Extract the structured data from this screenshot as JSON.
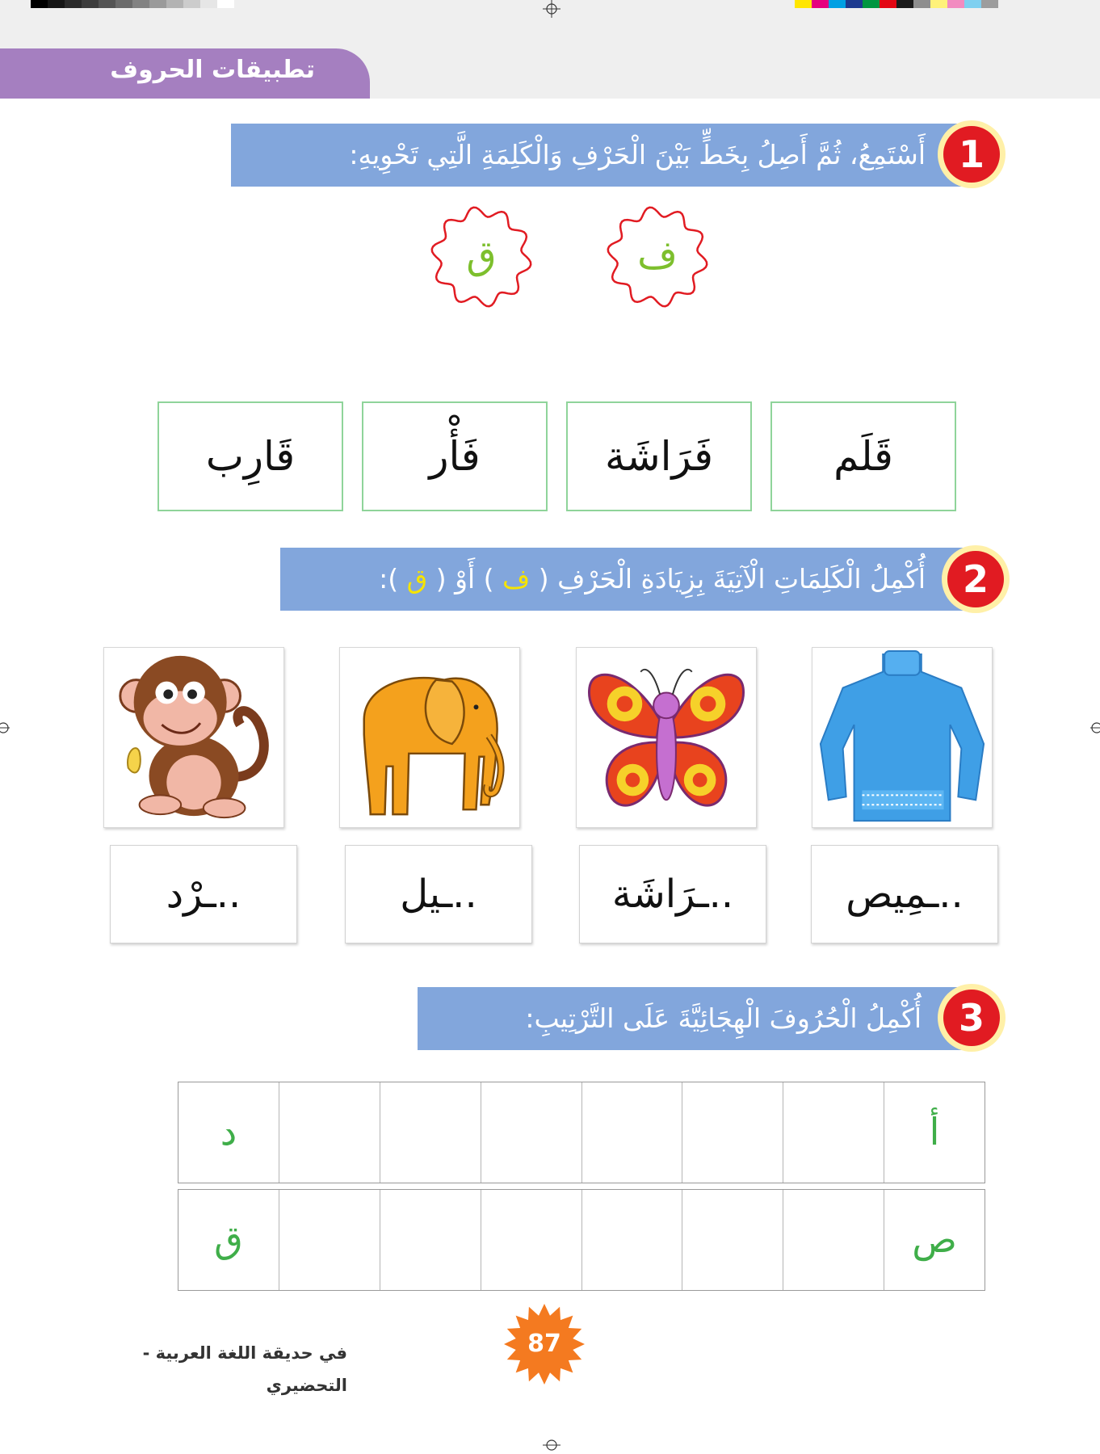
{
  "header": {
    "tab_title": "تطبيقات الحروف",
    "print_colors": {
      "grays": [
        "#000000",
        "#161616",
        "#2b2b2b",
        "#3d3d3d",
        "#545454",
        "#6b6b6b",
        "#828282",
        "#9a9a9a",
        "#b3b3b3",
        "#cccccc",
        "#e6e6e6",
        "#ffffff"
      ],
      "colors": [
        "#ffe600",
        "#e6007e",
        "#00a0e3",
        "#1d3a8f",
        "#009640",
        "#e30613",
        "#1b1b1b",
        "#8e8e8e",
        "#fff27a",
        "#f28cc0",
        "#7fd0f0",
        "#9d9d9d"
      ]
    }
  },
  "section1": {
    "number": "1",
    "instruction": "أَسْتَمِعُ، ثُمَّ أَصِلُ بِخَطٍّ بَيْنَ الْحَرْفِ وَالْكَلِمَةِ الَّتِي تَحْوِيهِ:",
    "letters": [
      "ف",
      "ق"
    ],
    "words": [
      "قَلَم",
      "فَرَاشَة",
      "فَأْر",
      "قَارِب"
    ]
  },
  "section2": {
    "number": "2",
    "instruction_before": "أُكْمِلُ الْكَلِمَاتِ الْآتِيَةَ بِزِيَادَةِ الْحَرْفِ (",
    "letter_a": "ف",
    "instruction_middle": ") أَوْ (",
    "letter_b": "ق",
    "instruction_after": "):",
    "images": [
      "sweater-image",
      "butterfly-image",
      "elephant-image",
      "monkey-image"
    ],
    "blanks": [
      "..ـمِيص",
      "..ـرَاشَة",
      "..ـيل",
      "..ـرْد"
    ]
  },
  "section3": {
    "number": "3",
    "instruction": "أُكْمِلُ الْحُرُوفَ الْهِجَائِيَّةَ عَلَى التَّرْتِيبِ:",
    "row1": [
      "أ",
      "",
      "",
      "",
      "",
      "",
      "",
      "د"
    ],
    "row2": [
      "ص",
      "",
      "",
      "",
      "",
      "",
      "",
      "ق"
    ]
  },
  "footer": {
    "book_title": "في حديقة اللغة العربية - التحضيري",
    "page_number": "87"
  },
  "colors": {
    "tab": "#a57fc0",
    "instruction_bar": "#82a6dc",
    "badge": "#e11b22",
    "badge_ring": "#fff0a8",
    "flower_border": "#e11b22",
    "letter_green": "#7dbf2d",
    "highlight_yellow": "#f6e400",
    "word_box_border": "#8fd49a",
    "page_star": "#f47a20"
  }
}
